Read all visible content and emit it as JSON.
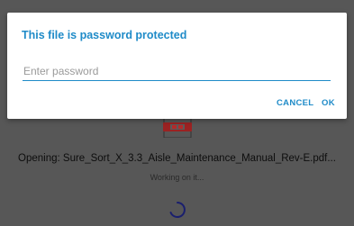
{
  "dialog": {
    "title": "This file is password protected",
    "password_placeholder": "Enter password",
    "password_value": "",
    "cancel_label": "CANCEL",
    "ok_label": "OK"
  },
  "background": {
    "opening_text": "Opening: Sure_Sort_X_3.3_Aisle_Maintenance_Manual_Rev-E.pdf...",
    "status_text": "Working on it..."
  },
  "icons": {
    "file": "pdf-file-icon",
    "loading": "loading-spinner-icon"
  },
  "colors": {
    "accent": "#1f8bc8",
    "icon_red": "#9b2222"
  }
}
